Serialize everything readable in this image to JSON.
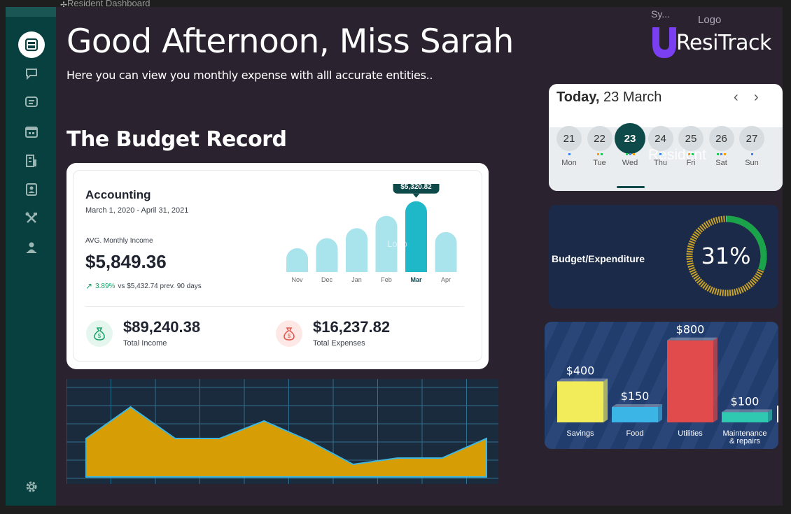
{
  "window": {
    "title": "Resident Dashboard"
  },
  "colors": {
    "sidebar": "#07403f",
    "frame_bg": "#2b2230",
    "brand_purple": "#7b3ff2",
    "teal_accent": "#1fb8c9",
    "area_fill": "#d69e04",
    "gauge_green": "#1aa34a",
    "gauge_gold": "#c9a227"
  },
  "sidebar": {
    "items": [
      {
        "icon": "home-icon"
      },
      {
        "icon": "chat-icon"
      },
      {
        "icon": "message-icon"
      },
      {
        "icon": "calendar-icon"
      },
      {
        "icon": "building-icon"
      },
      {
        "icon": "contacts-icon"
      },
      {
        "icon": "tools-icon"
      },
      {
        "icon": "person-icon"
      }
    ],
    "bottom_icon": "settings-icon"
  },
  "header": {
    "greeting": "Good Afternoon, Miss Sarah",
    "subtitle": "Here you can view you monthly expense with alll accurate entities..",
    "sys_label": "Sy...",
    "logo_label": "Logo",
    "brand_name": "ResiTrack"
  },
  "budget_section": {
    "title": "The Budget Record"
  },
  "accounting": {
    "title": "Accounting",
    "date_range": "March 1, 2020 - April 31, 2021",
    "avg_label": "AVG. Monthly Income",
    "avg_value": "$5,849.36",
    "trend_pct": "3.89%",
    "trend_text": "vs $5,432.74 prev. 90 days",
    "watermark": "Logo",
    "total_income": {
      "value": "$89,240.38",
      "label": "Total Income"
    },
    "total_expenses": {
      "value": "$16,237.82",
      "label": "Total Expenses"
    },
    "chart_data": {
      "type": "bar",
      "categories": [
        "Nov",
        "Dec",
        "Jan",
        "Feb",
        "Mar",
        "Apr"
      ],
      "values": [
        3100,
        4400,
        5700,
        7300,
        9200,
        5200
      ],
      "highlight_index": 4,
      "tooltip": "$5,320.82",
      "ylim": [
        0,
        10000
      ]
    }
  },
  "area_chart": {
    "chart_data": {
      "type": "area",
      "x": [
        1,
        2,
        3,
        4,
        5,
        6,
        7,
        8,
        9,
        10
      ],
      "values": [
        55,
        100,
        55,
        55,
        80,
        52,
        18,
        27,
        27,
        55
      ],
      "ylim": [
        0,
        110
      ],
      "grid": true
    }
  },
  "calendar": {
    "today_label": "Today,",
    "today_date": "23 March",
    "prev": "‹",
    "next": "›",
    "ghost_text": "Resident",
    "days": [
      {
        "num": "21",
        "wd": "Mon"
      },
      {
        "num": "22",
        "wd": "Tue"
      },
      {
        "num": "23",
        "wd": "Wed",
        "active": true
      },
      {
        "num": "24",
        "wd": "Thu"
      },
      {
        "num": "25",
        "wd": "Fri"
      },
      {
        "num": "26",
        "wd": "Sat"
      },
      {
        "num": "27",
        "wd": "Sun"
      }
    ]
  },
  "budget_gauge": {
    "label": "Budget/Expenditure",
    "value_text": "31%",
    "value": 0.31
  },
  "expense_bars": {
    "chart_data": {
      "type": "bar",
      "categories": [
        "Savings",
        "Food",
        "Utilities",
        "Maintenance & repairs"
      ],
      "category_lines": [
        [
          "Savings"
        ],
        [
          "Food"
        ],
        [
          "Utilities"
        ],
        [
          "Maintenance",
          "& repairs"
        ]
      ],
      "values": [
        400,
        150,
        800,
        100
      ],
      "value_labels": [
        "$400",
        "$150",
        "$800",
        "$100"
      ],
      "colors": [
        "#f2ec5a",
        "#3ab5e6",
        "#e24b4b",
        "#2fc8b0"
      ],
      "ylim": [
        0,
        900
      ]
    }
  }
}
